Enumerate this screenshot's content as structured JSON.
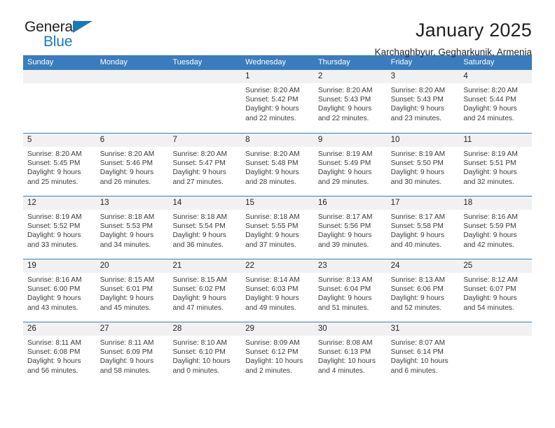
{
  "brand": {
    "name_part1": "General",
    "name_part2": "Blue",
    "accent_color": "#1878be"
  },
  "header": {
    "title": "January 2025",
    "subtitle": "Karchaghbyur, Gegharkunik, Armenia"
  },
  "theme": {
    "header_blue": "#3a7cbd",
    "date_strip": "#f1f1f1",
    "text": "#231f20"
  },
  "calendar": {
    "weekday_headers": [
      "Sunday",
      "Monday",
      "Tuesday",
      "Wednesday",
      "Thursday",
      "Friday",
      "Saturday"
    ],
    "weeks": [
      [
        {
          "date": "",
          "lines": []
        },
        {
          "date": "",
          "lines": []
        },
        {
          "date": "",
          "lines": []
        },
        {
          "date": "1",
          "lines": [
            "Sunrise: 8:20 AM",
            "Sunset: 5:42 PM",
            "Daylight: 9 hours",
            "and 22 minutes."
          ]
        },
        {
          "date": "2",
          "lines": [
            "Sunrise: 8:20 AM",
            "Sunset: 5:43 PM",
            "Daylight: 9 hours",
            "and 22 minutes."
          ]
        },
        {
          "date": "3",
          "lines": [
            "Sunrise: 8:20 AM",
            "Sunset: 5:43 PM",
            "Daylight: 9 hours",
            "and 23 minutes."
          ]
        },
        {
          "date": "4",
          "lines": [
            "Sunrise: 8:20 AM",
            "Sunset: 5:44 PM",
            "Daylight: 9 hours",
            "and 24 minutes."
          ]
        }
      ],
      [
        {
          "date": "5",
          "lines": [
            "Sunrise: 8:20 AM",
            "Sunset: 5:45 PM",
            "Daylight: 9 hours",
            "and 25 minutes."
          ]
        },
        {
          "date": "6",
          "lines": [
            "Sunrise: 8:20 AM",
            "Sunset: 5:46 PM",
            "Daylight: 9 hours",
            "and 26 minutes."
          ]
        },
        {
          "date": "7",
          "lines": [
            "Sunrise: 8:20 AM",
            "Sunset: 5:47 PM",
            "Daylight: 9 hours",
            "and 27 minutes."
          ]
        },
        {
          "date": "8",
          "lines": [
            "Sunrise: 8:20 AM",
            "Sunset: 5:48 PM",
            "Daylight: 9 hours",
            "and 28 minutes."
          ]
        },
        {
          "date": "9",
          "lines": [
            "Sunrise: 8:19 AM",
            "Sunset: 5:49 PM",
            "Daylight: 9 hours",
            "and 29 minutes."
          ]
        },
        {
          "date": "10",
          "lines": [
            "Sunrise: 8:19 AM",
            "Sunset: 5:50 PM",
            "Daylight: 9 hours",
            "and 30 minutes."
          ]
        },
        {
          "date": "11",
          "lines": [
            "Sunrise: 8:19 AM",
            "Sunset: 5:51 PM",
            "Daylight: 9 hours",
            "and 32 minutes."
          ]
        }
      ],
      [
        {
          "date": "12",
          "lines": [
            "Sunrise: 8:19 AM",
            "Sunset: 5:52 PM",
            "Daylight: 9 hours",
            "and 33 minutes."
          ]
        },
        {
          "date": "13",
          "lines": [
            "Sunrise: 8:18 AM",
            "Sunset: 5:53 PM",
            "Daylight: 9 hours",
            "and 34 minutes."
          ]
        },
        {
          "date": "14",
          "lines": [
            "Sunrise: 8:18 AM",
            "Sunset: 5:54 PM",
            "Daylight: 9 hours",
            "and 36 minutes."
          ]
        },
        {
          "date": "15",
          "lines": [
            "Sunrise: 8:18 AM",
            "Sunset: 5:55 PM",
            "Daylight: 9 hours",
            "and 37 minutes."
          ]
        },
        {
          "date": "16",
          "lines": [
            "Sunrise: 8:17 AM",
            "Sunset: 5:56 PM",
            "Daylight: 9 hours",
            "and 39 minutes."
          ]
        },
        {
          "date": "17",
          "lines": [
            "Sunrise: 8:17 AM",
            "Sunset: 5:58 PM",
            "Daylight: 9 hours",
            "and 40 minutes."
          ]
        },
        {
          "date": "18",
          "lines": [
            "Sunrise: 8:16 AM",
            "Sunset: 5:59 PM",
            "Daylight: 9 hours",
            "and 42 minutes."
          ]
        }
      ],
      [
        {
          "date": "19",
          "lines": [
            "Sunrise: 8:16 AM",
            "Sunset: 6:00 PM",
            "Daylight: 9 hours",
            "and 43 minutes."
          ]
        },
        {
          "date": "20",
          "lines": [
            "Sunrise: 8:15 AM",
            "Sunset: 6:01 PM",
            "Daylight: 9 hours",
            "and 45 minutes."
          ]
        },
        {
          "date": "21",
          "lines": [
            "Sunrise: 8:15 AM",
            "Sunset: 6:02 PM",
            "Daylight: 9 hours",
            "and 47 minutes."
          ]
        },
        {
          "date": "22",
          "lines": [
            "Sunrise: 8:14 AM",
            "Sunset: 6:03 PM",
            "Daylight: 9 hours",
            "and 49 minutes."
          ]
        },
        {
          "date": "23",
          "lines": [
            "Sunrise: 8:13 AM",
            "Sunset: 6:04 PM",
            "Daylight: 9 hours",
            "and 51 minutes."
          ]
        },
        {
          "date": "24",
          "lines": [
            "Sunrise: 8:13 AM",
            "Sunset: 6:06 PM",
            "Daylight: 9 hours",
            "and 52 minutes."
          ]
        },
        {
          "date": "25",
          "lines": [
            "Sunrise: 8:12 AM",
            "Sunset: 6:07 PM",
            "Daylight: 9 hours",
            "and 54 minutes."
          ]
        }
      ],
      [
        {
          "date": "26",
          "lines": [
            "Sunrise: 8:11 AM",
            "Sunset: 6:08 PM",
            "Daylight: 9 hours",
            "and 56 minutes."
          ]
        },
        {
          "date": "27",
          "lines": [
            "Sunrise: 8:11 AM",
            "Sunset: 6:09 PM",
            "Daylight: 9 hours",
            "and 58 minutes."
          ]
        },
        {
          "date": "28",
          "lines": [
            "Sunrise: 8:10 AM",
            "Sunset: 6:10 PM",
            "Daylight: 10 hours",
            "and 0 minutes."
          ]
        },
        {
          "date": "29",
          "lines": [
            "Sunrise: 8:09 AM",
            "Sunset: 6:12 PM",
            "Daylight: 10 hours",
            "and 2 minutes."
          ]
        },
        {
          "date": "30",
          "lines": [
            "Sunrise: 8:08 AM",
            "Sunset: 6:13 PM",
            "Daylight: 10 hours",
            "and 4 minutes."
          ]
        },
        {
          "date": "31",
          "lines": [
            "Sunrise: 8:07 AM",
            "Sunset: 6:14 PM",
            "Daylight: 10 hours",
            "and 6 minutes."
          ]
        },
        {
          "date": "",
          "lines": []
        }
      ]
    ]
  }
}
